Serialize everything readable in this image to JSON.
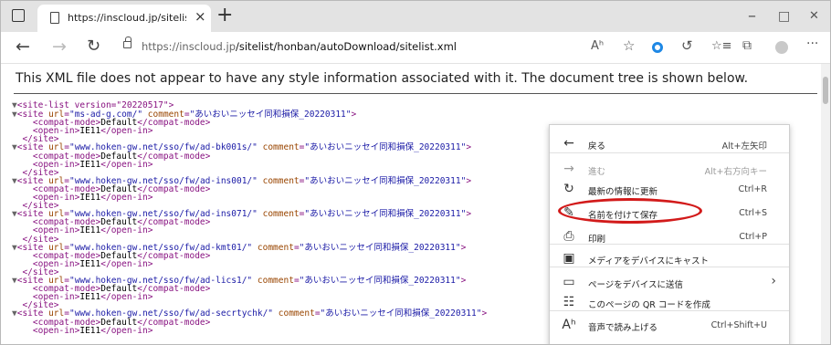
{
  "browser": {
    "tab_title": "https://inscloud.jp/sitelist/honba",
    "url_host": "https://inscloud.jp",
    "url_path": "/sitelist/honban/autoDownload/sitelist.xml",
    "read_aloud_glyph": "Aʰ",
    "window": {
      "minimize": "–",
      "maximize": "□",
      "close": "✕"
    }
  },
  "page": {
    "notice": "This XML file does not appear to have any style information associated with it. The document tree is shown below."
  },
  "xml": {
    "root_open": "<site-list version=\"20220517\">",
    "root_attr_name": "version",
    "root_attr_value": "20220517",
    "compat_mode": "Default",
    "open_in": "IE11",
    "comment": "あいおいニッセイ同和損保_20220311",
    "sites": [
      {
        "url": "ms-ad-g.com/"
      },
      {
        "url": "www.hoken-gw.net/sso/fw/ad-bk001s/"
      },
      {
        "url": "www.hoken-gw.net/sso/fw/ad-ins001/"
      },
      {
        "url": "www.hoken-gw.net/sso/fw/ad-ins071/"
      },
      {
        "url": "www.hoken-gw.net/sso/fw/ad-kmt01/"
      },
      {
        "url": "www.hoken-gw.net/sso/fw/ad-lics1/"
      },
      {
        "url": "www.hoken-gw.net/sso/fw/ad-secrtychk/"
      }
    ]
  },
  "context_menu": {
    "items": [
      {
        "icon": "back-arrow-icon",
        "glyph": "←",
        "label": "戻る",
        "shortcut": "Alt+左矢印",
        "disabled": false
      },
      {
        "icon": "forward-arrow-icon",
        "glyph": "→",
        "label": "進む",
        "shortcut": "Alt+右方向キー",
        "disabled": true
      },
      {
        "icon": "refresh-icon",
        "glyph": "↻",
        "label": "最新の情報に更新",
        "shortcut": "Ctrl+R",
        "disabled": false
      },
      {
        "icon": "save-as-icon",
        "glyph": "✎",
        "label": "名前を付けて保存",
        "shortcut": "Ctrl+S",
        "disabled": false
      },
      {
        "icon": "print-icon",
        "glyph": "⎙",
        "label": "印刷",
        "shortcut": "Ctrl+P",
        "disabled": false
      },
      {
        "icon": "cast-icon",
        "glyph": "▣",
        "label": "メディアをデバイスにキャスト",
        "shortcut": "",
        "disabled": false
      },
      {
        "icon": "send-to-device-icon",
        "glyph": "▭",
        "label": "ページをデバイスに送信",
        "shortcut": "›",
        "disabled": false
      },
      {
        "icon": "qr-code-icon",
        "glyph": "☷",
        "label": "このページの QR コードを作成",
        "shortcut": "",
        "disabled": false
      },
      {
        "icon": "read-aloud-icon",
        "glyph": "Aʰ",
        "label": "音声で読み上げる",
        "shortcut": "Ctrl+Shift+U",
        "disabled": false
      }
    ],
    "highlighted_item": "名前を付けて保存",
    "highlight_color": "#d21a1a"
  }
}
